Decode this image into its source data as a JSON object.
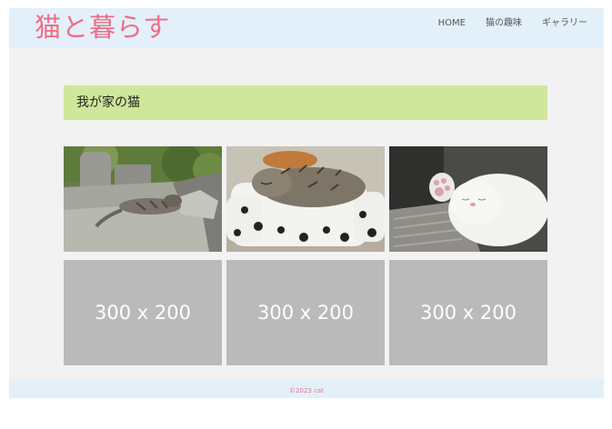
{
  "site": {
    "logo": "猫と暮らす"
  },
  "nav": {
    "items": [
      "HOME",
      "猫の趣味",
      "ギャラリー"
    ]
  },
  "section": {
    "title": "我が家の猫"
  },
  "gallery": {
    "photos": [
      {
        "alt": "tabby cat lying on stone wall"
      },
      {
        "alt": "tabby cat sleeping in dalmatian bed"
      },
      {
        "alt": "white cat sleeping with paw up"
      }
    ],
    "placeholders": [
      "300 x 200",
      "300 x 200",
      "300 x 200"
    ]
  },
  "footer": {
    "copyright": "©2023 cat"
  },
  "colors": {
    "accent": "#ee6e86",
    "header_bg": "#e3f0fa",
    "title_bg": "#cfe79b",
    "placeholder_bg": "#bababa"
  }
}
